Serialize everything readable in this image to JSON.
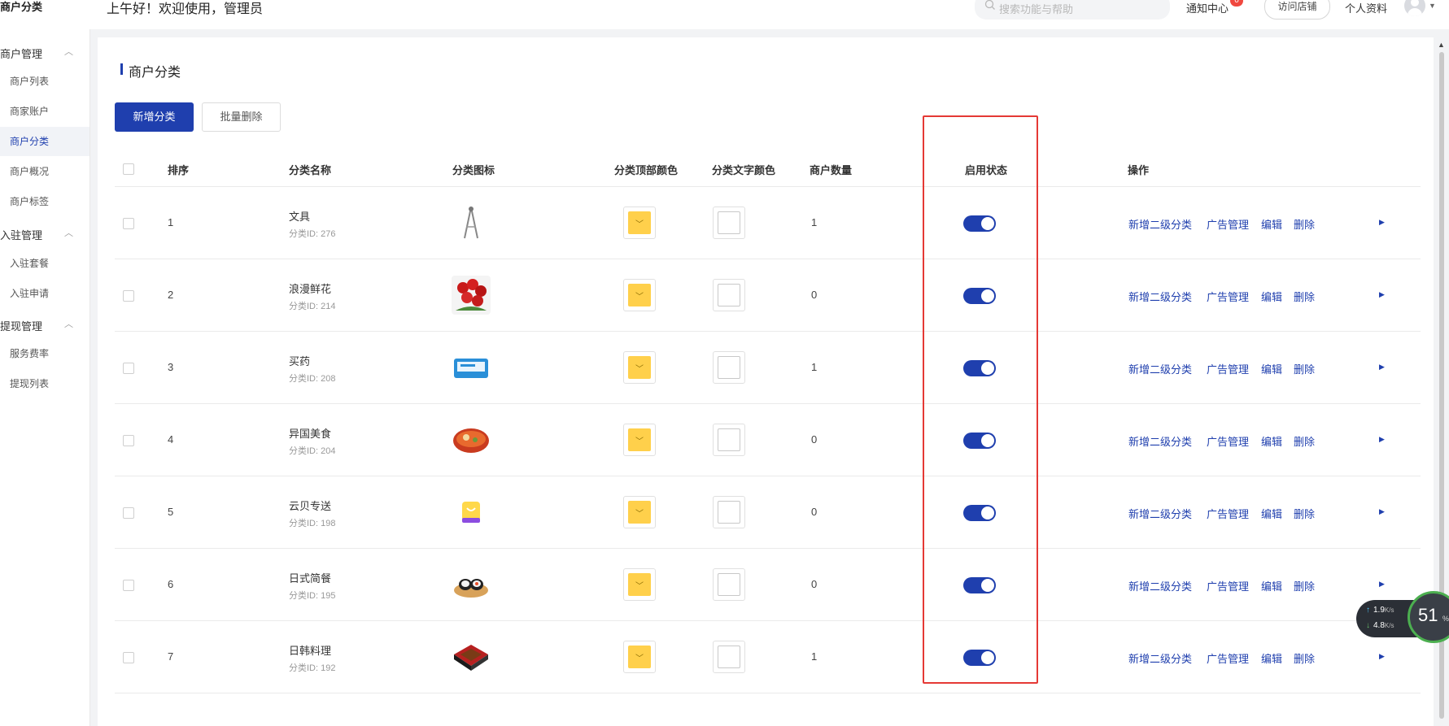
{
  "sidebar": {
    "header": "商户分类",
    "groups": [
      {
        "label": "商户管理",
        "items": [
          "商户列表",
          "商家账户",
          "商户分类",
          "商户概况",
          "商户标签"
        ]
      },
      {
        "label": "入驻管理",
        "items": [
          "入驻套餐",
          "入驻申请"
        ]
      },
      {
        "label": "提现管理",
        "items": [
          "服务费率",
          "提现列表"
        ]
      }
    ],
    "active_item": "商户分类"
  },
  "header": {
    "welcome": "上午好！欢迎使用，管理员",
    "search_placeholder": "搜索功能与帮助",
    "notice_label": "通知中心",
    "notice_badge": "0",
    "visit_store": "访问店铺",
    "profile": "个人资料"
  },
  "page": {
    "title": "商户分类",
    "add_button": "新增分类",
    "batch_delete_button": "批量删除"
  },
  "table": {
    "columns": [
      "排序",
      "分类名称",
      "分类图标",
      "分类顶部颜色",
      "分类文字颜色",
      "商户数量",
      "启用状态",
      "操作"
    ],
    "rows": [
      {
        "sort": "1",
        "name": "文具",
        "id": "分类ID: 276",
        "icon": "compass-icon",
        "count": "1",
        "enabled": true
      },
      {
        "sort": "2",
        "name": "浪漫鲜花",
        "id": "分类ID: 214",
        "icon": "roses-icon",
        "count": "0",
        "enabled": true
      },
      {
        "sort": "3",
        "name": "买药",
        "id": "分类ID: 208",
        "icon": "medicine-box-icon",
        "count": "1",
        "enabled": true
      },
      {
        "sort": "4",
        "name": "异国美食",
        "id": "分类ID: 204",
        "icon": "noodle-bowl-icon",
        "count": "0",
        "enabled": true
      },
      {
        "sort": "5",
        "name": "云贝专送",
        "id": "分类ID: 198",
        "icon": "shopping-bag-icon",
        "count": "0",
        "enabled": true
      },
      {
        "sort": "6",
        "name": "日式简餐",
        "id": "分类ID: 195",
        "icon": "sushi-icon",
        "count": "0",
        "enabled": true
      },
      {
        "sort": "7",
        "name": "日韩料理",
        "id": "分类ID: 192",
        "icon": "bento-box-icon",
        "count": "1",
        "enabled": true
      }
    ],
    "actions": [
      "新增二级分类",
      "广告管理",
      "编辑",
      "删除"
    ]
  },
  "colors": {
    "primary": "#1f3fae",
    "top_color_swatch": "#ffd04b",
    "text_color_swatch": "#ffffff",
    "highlight_border": "#e53935"
  },
  "network_widget": {
    "up_value": "1.9",
    "down_value": "4.8",
    "unit": "K/s",
    "percent": "51",
    "percent_sign": "%"
  }
}
